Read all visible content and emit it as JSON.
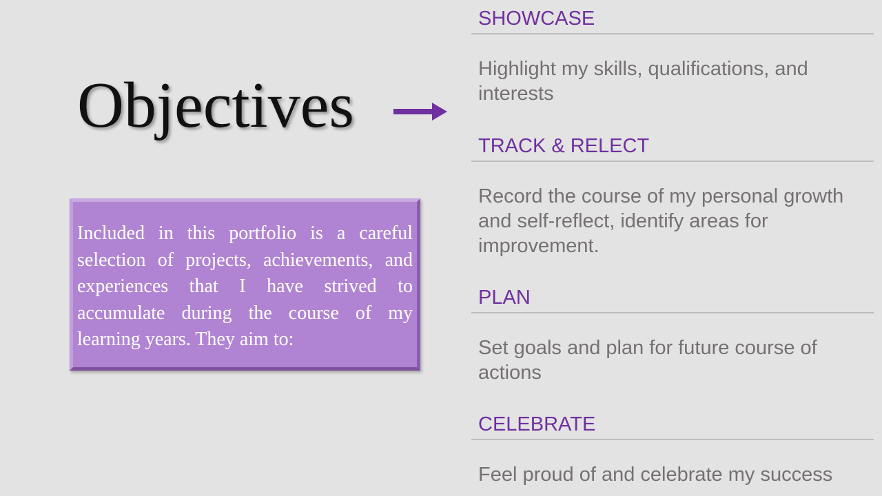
{
  "slide": {
    "title": "Objectives",
    "accent_color": "#7030a0",
    "box_color": "#b084d2",
    "intro": "Included in this portfolio is a careful selection of projects, achievements, and experiences that I have strived to accumulate during the course of my learning years. They aim to:",
    "arrow_icon": "right-arrow-icon"
  },
  "sections": [
    {
      "heading": "SHOWCASE",
      "description": "Highlight my skills, qualifications, and interests"
    },
    {
      "heading": "TRACK & RELECT",
      "description": "Record the course of my personal growth and self-reflect, identify areas for improvement."
    },
    {
      "heading": "PLAN",
      "description": "Set goals and plan for future course of actions"
    },
    {
      "heading": "CELEBRATE",
      "description": "Feel proud of and celebrate my success"
    }
  ]
}
